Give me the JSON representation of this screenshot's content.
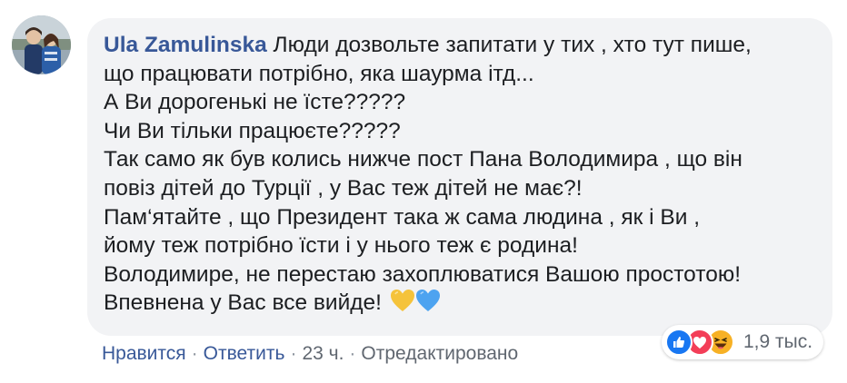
{
  "comment": {
    "author": "Ula Zamulinska",
    "lines": [
      "Люди дозвольте запитати у тих , хто тут пише,",
      "що працювати потрібно, яка шаурма ітд...",
      "А Ви дорогенькі не їсте?????",
      "Чи Ви тільки працюєте?????",
      "Так само як був колись нижче пост Пана Володимира , що він",
      "повіз дітей до Турції , у Вас теж дітей не має?!",
      "Пам‘ятайте , що Президент така ж сама людина , як і Ви ,",
      "йому теж потрібно їсти і у нього теж є родина!",
      "Володимире, не перестаю захоплюватися Вашою простотою!",
      "Впевнена у Вас все вийде!"
    ],
    "emoji": [
      "yellow-heart-icon",
      "blue-heart-icon"
    ]
  },
  "reactions": {
    "icons": [
      "like-icon",
      "love-icon",
      "haha-icon"
    ],
    "count": "1,9 тыс."
  },
  "actions": {
    "like_label": "Нравится",
    "reply_label": "Ответить",
    "separator": "·",
    "time": "23 ч.",
    "edited_label": "Отредактировано"
  },
  "colors": {
    "author_link": "#385898",
    "bubble_bg": "#f2f3f5",
    "text": "#1c1e21",
    "meta": "#606770",
    "like_blue": "#1877f2",
    "love_red": "#f33e58",
    "haha_yellow": "#f7b125",
    "heart_yellow": "#f5c33b",
    "heart_blue": "#4da3f0"
  }
}
